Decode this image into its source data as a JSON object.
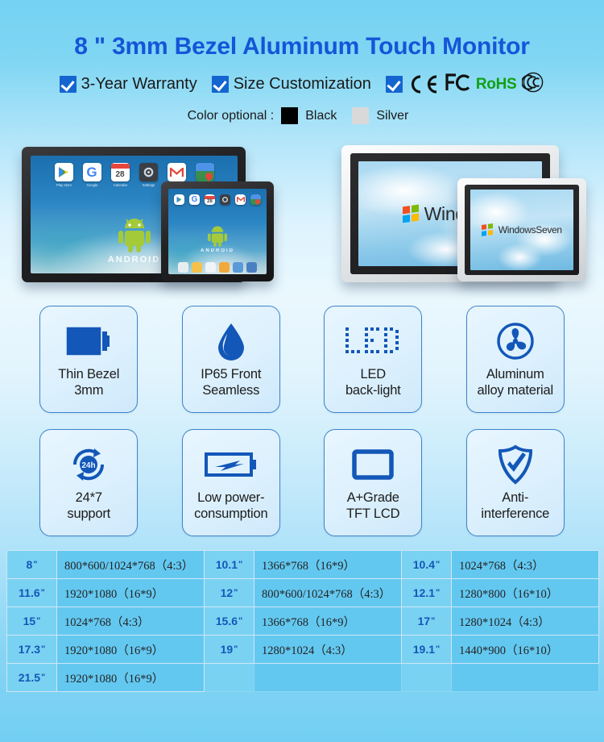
{
  "title": "8 \" 3mm Bezel Aluminum Touch Monitor",
  "badges": [
    {
      "label": "3-Year Warranty"
    },
    {
      "label": "Size Customization"
    }
  ],
  "certifications": {
    "ce": "CE",
    "fcc": "FC",
    "rohs": "RoHS",
    "ccc": "CCC"
  },
  "color_optional": {
    "label": "Color optional :",
    "options": [
      {
        "name": "Black",
        "hex": "#000000"
      },
      {
        "name": "Silver",
        "hex": "#d9d9d9"
      }
    ]
  },
  "products": {
    "android_apps": [
      "Play store",
      "Google",
      "Calendar",
      "Settings",
      "Gmail",
      "Maps"
    ],
    "android_word": "ANDROID",
    "windows_big_text": "Windows",
    "windows_small_text": "WindowsSeven"
  },
  "features": [
    {
      "caption_1": "Thin Bezel",
      "caption_2": "3mm",
      "icon": "thin-bezel-icon"
    },
    {
      "caption_1": "IP65 Front",
      "caption_2": "Seamless",
      "icon": "water-drop-icon"
    },
    {
      "caption_1": "LED",
      "caption_2": "back-light",
      "icon": "led-dot-matrix-icon",
      "icon_text": "LED"
    },
    {
      "caption_1": "Aluminum",
      "caption_2": "alloy material",
      "icon": "fan-icon"
    },
    {
      "caption_1": "24*7",
      "caption_2": "support",
      "icon": "24h-support-icon",
      "icon_text": "24h"
    },
    {
      "caption_1": "Low power-",
      "caption_2": "consumption",
      "icon": "battery-bolt-icon"
    },
    {
      "caption_1": "A+Grade",
      "caption_2": "TFT LCD",
      "icon": "lcd-screen-icon"
    },
    {
      "caption_1": "Anti-",
      "caption_2": "interference",
      "icon": "shield-check-icon"
    }
  ],
  "spec_table": {
    "rows": [
      [
        {
          "size": "8",
          "res": "800*600/1024*768（4:3）"
        },
        {
          "size": "10.1",
          "res": "1366*768（16*9）"
        },
        {
          "size": "10.4",
          "res": "1024*768（4:3）"
        }
      ],
      [
        {
          "size": "11.6",
          "res": "1920*1080（16*9）"
        },
        {
          "size": "12",
          "res": "800*600/1024*768（4:3）"
        },
        {
          "size": "12.1",
          "res": "1280*800（16*10）"
        }
      ],
      [
        {
          "size": "15",
          "res": "1024*768（4:3）"
        },
        {
          "size": "15.6",
          "res": "1366*768（16*9）"
        },
        {
          "size": "17",
          "res": "1280*1024（4:3）"
        }
      ],
      [
        {
          "size": "17.3",
          "res": "1920*1080（16*9）"
        },
        {
          "size": "19",
          "res": "1280*1024（4:3）"
        },
        {
          "size": "19.1",
          "res": "1440*900（16*10）"
        }
      ],
      [
        {
          "size": "21.5",
          "res": "1920*1080（16*9）"
        },
        {
          "size": "",
          "res": ""
        },
        {
          "size": "",
          "res": ""
        }
      ]
    ],
    "unit_mark": "\""
  },
  "colors": {
    "title_blue": "#1555d8",
    "icon_blue": "#1357b8",
    "rohs_green": "#12a114",
    "table_cell": "#63c8f0",
    "table_size_cell": "#7ad2f2"
  }
}
